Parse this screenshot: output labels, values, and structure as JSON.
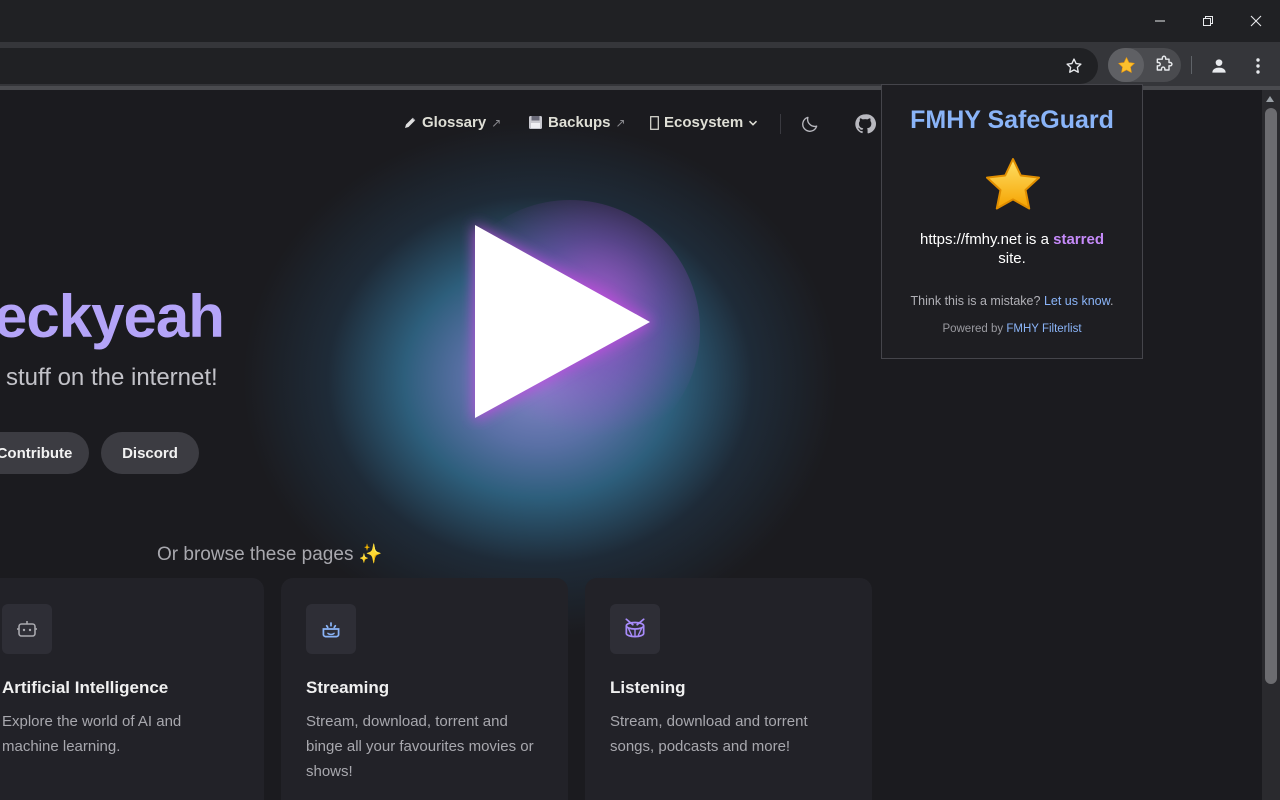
{
  "nav": {
    "glossary": "Glossary",
    "backups": "Backups",
    "ecosystem": "Ecosystem",
    "ext_arrow": "↗"
  },
  "hero": {
    "name": "eckyeah",
    "tagline": "stuff on the internet!",
    "buttons": {
      "contribute": "Contribute",
      "discord": "Discord"
    }
  },
  "browse": {
    "heading": "Or browse these pages ✨",
    "cards": [
      {
        "title": "Artificial Intelligence",
        "description": "Explore the world of AI and machine learning.",
        "icon": "robot-icon"
      },
      {
        "title": "Streaming",
        "description": "Stream, download, torrent and binge all your favourites movies or shows!",
        "icon": "streaming-icon"
      },
      {
        "title": "Listening",
        "description": "Stream, download and torrent songs, podcasts and more!",
        "icon": "drum-icon"
      }
    ]
  },
  "popup": {
    "title": "FMHY SafeGuard",
    "msg_prefix": "https://fmhy.net is a",
    "msg_highlight": "starred",
    "msg_suffix": "site.",
    "mistake_text": "Think this is a mistake?",
    "mistake_link": "Let us know",
    "mistake_period": ".",
    "powered_text": "Powered by",
    "powered_link": "FMHY Filterlist"
  },
  "colors": {
    "accent": "#b4a4f8",
    "link": "#8ab4f8",
    "starred": "#c58af9",
    "background": "#1b1b1f",
    "card": "#222228"
  }
}
